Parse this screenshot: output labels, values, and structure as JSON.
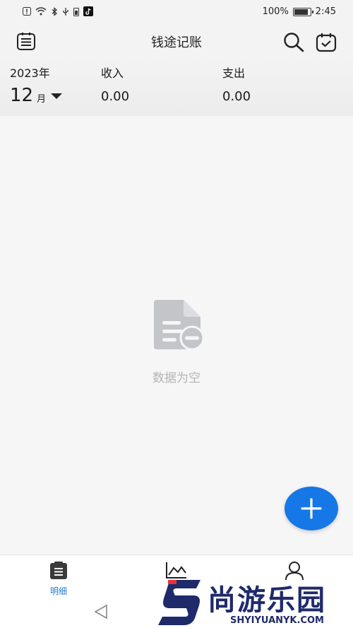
{
  "status_bar": {
    "battery": "100%",
    "time": "2:45"
  },
  "header": {
    "title": "钱途记账"
  },
  "summary": {
    "year": "2023年",
    "month": "12",
    "month_unit": "月",
    "income_label": "收入",
    "income_value": "0.00",
    "expense_label": "支出",
    "expense_value": "0.00"
  },
  "empty_state": {
    "text": "数据为空"
  },
  "tabs": [
    {
      "label": "明细",
      "icon": "list-icon",
      "active": true
    },
    {
      "label": "",
      "icon": "chart-icon",
      "active": false
    },
    {
      "label": "",
      "icon": "user-icon",
      "active": false
    }
  ],
  "watermark": {
    "text": "尚游乐园",
    "sub": "SHYIYUANYK.COM"
  },
  "colors": {
    "accent": "#1677e6",
    "tab_active": "#1b7ad6",
    "empty_text": "#b4b4b4"
  }
}
